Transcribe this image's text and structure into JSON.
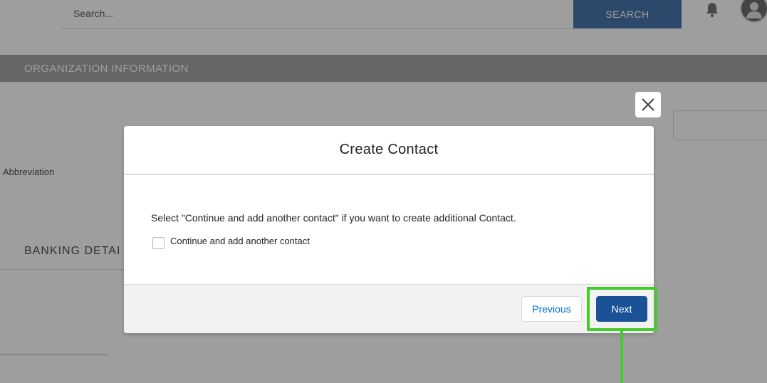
{
  "search": {
    "placeholder": "Search...",
    "button_label": "SEARCH"
  },
  "header": {
    "notifications_icon": "bell-icon",
    "avatar_icon": "user-avatar-icon"
  },
  "section": {
    "title": "ORGANIZATION INFORMATION"
  },
  "form": {
    "abbreviation_label": "Abbreviation",
    "banking_heading": "BANKING DETAI"
  },
  "modal": {
    "title": "Create Contact",
    "close_icon": "close-icon",
    "message": "Select \"Continue and add another contact\" if you want to create additional Contact.",
    "checkbox_label": "Continue and add another contact",
    "checkbox_checked": false,
    "previous_label": "Previous",
    "next_label": "Next"
  },
  "colors": {
    "brand": "#1b5297",
    "highlight": "#44cc2c",
    "link": "#0070d2",
    "section_bar": "#8e8e8e"
  }
}
